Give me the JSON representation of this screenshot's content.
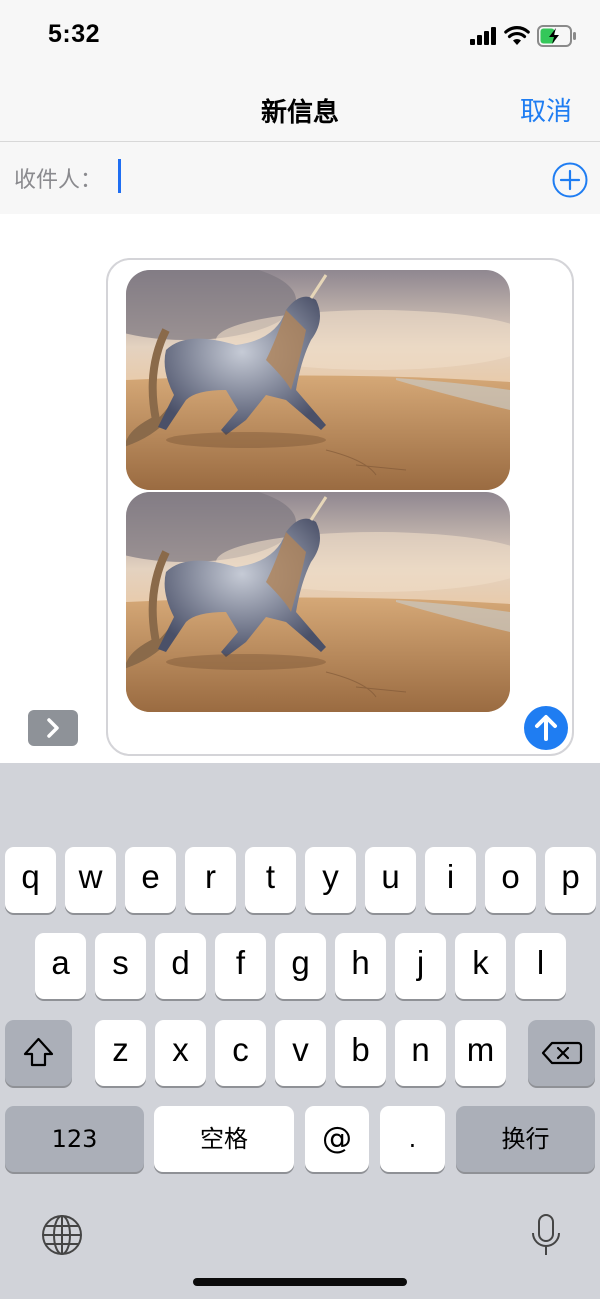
{
  "status_bar": {
    "time": "5:32"
  },
  "nav": {
    "title": "新信息",
    "cancel_label": "取消"
  },
  "recipient": {
    "label": "收件人：",
    "value": ""
  },
  "compose": {
    "attachments": [
      {
        "description_icon": "unicorn-on-beach-image"
      },
      {
        "description_icon": "unicorn-on-beach-image"
      }
    ],
    "send_icon": "arrow-up-icon",
    "expand_icon": "chevron-right-icon"
  },
  "keyboard": {
    "row1": [
      "q",
      "w",
      "e",
      "r",
      "t",
      "y",
      "u",
      "i",
      "o",
      "p"
    ],
    "row2": [
      "a",
      "s",
      "d",
      "f",
      "g",
      "h",
      "j",
      "k",
      "l"
    ],
    "row3": [
      "z",
      "x",
      "c",
      "v",
      "b",
      "n",
      "m"
    ],
    "numbers_label": "123",
    "space_label": "空格",
    "at_label": "@",
    "dot_label": ".",
    "return_label": "换行"
  },
  "colors": {
    "accent": "#1f7df2",
    "keyboard_bg": "#d1d3d9",
    "dark_key": "#abafb8"
  }
}
